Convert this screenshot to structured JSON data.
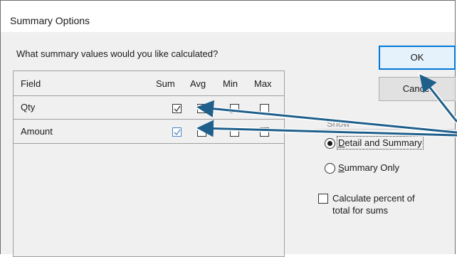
{
  "dialog": {
    "title": "Summary Options",
    "question": "What summary values would you like calculated?"
  },
  "grid": {
    "headers": {
      "field": "Field",
      "sum": "Sum",
      "avg": "Avg",
      "min": "Min",
      "max": "Max"
    },
    "rows": [
      {
        "field": "Qty",
        "sum": true,
        "avg": false,
        "min": false,
        "max": false
      },
      {
        "field": "Amount",
        "sum": true,
        "avg": false,
        "min": false,
        "max": false
      }
    ]
  },
  "buttons": {
    "ok": "OK",
    "cancel": "Cancel"
  },
  "show": {
    "label": "Show",
    "options": [
      {
        "prefix": "",
        "underline": "D",
        "rest": "etail and Summary",
        "selected": true
      },
      {
        "prefix": "",
        "underline": "S",
        "rest": "ummary Only",
        "selected": false
      }
    ]
  },
  "percent": {
    "line1": "Calculate percent of",
    "line2": "total for sums",
    "checked": false
  },
  "colors": {
    "annotation_arrow": "#1f5f8b",
    "ok_focus": "#0078d7"
  }
}
